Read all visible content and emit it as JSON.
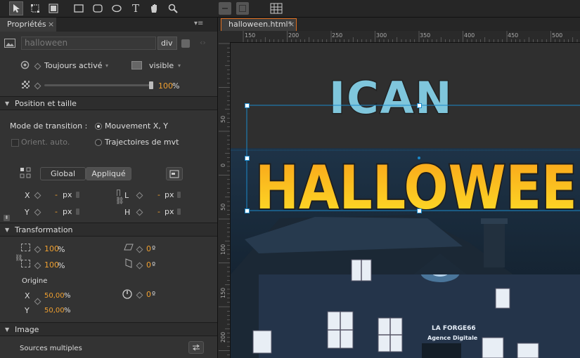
{
  "toolbar": {
    "tools": [
      {
        "name": "select-tool-icon",
        "selected": true
      },
      {
        "name": "transform-tool-icon"
      },
      {
        "name": "crop-tool-icon"
      },
      {
        "name": "rectangle-tool-icon"
      },
      {
        "name": "rounded-rectangle-tool-icon"
      },
      {
        "name": "ellipse-tool-icon"
      },
      {
        "name": "text-tool-icon",
        "glyph": "T"
      },
      {
        "name": "hand-tool-icon"
      },
      {
        "name": "zoom-tool-icon"
      }
    ]
  },
  "properties": {
    "tab_label": "Propriétés",
    "element_name": "halloween",
    "element_tag": "div",
    "display_label": "Toujours activé",
    "visibility_label": "visible",
    "opacity_value": "100",
    "opacity_unit": "%",
    "opacity_fraction": 1.0,
    "sections": {
      "position": "Position et taille",
      "transformation": "Transformation",
      "image": "Image"
    },
    "transition_mode_label": "Mode de transition :",
    "radio_xy": "Mouvement X, Y",
    "radio_path": "Trajectoires de mvt",
    "orient_auto": "Orient. auto.",
    "toggle_global": "Global",
    "toggle_applied": "Appliqué",
    "x_label": "X",
    "y_label": "Y",
    "l_label": "L",
    "h_label": "H",
    "dash": "-",
    "px": "px",
    "scale_x": "100",
    "scale_y": "100",
    "percent": "%",
    "skew_value": "0",
    "skew_unit": "º",
    "rotate_value": "0",
    "origin_label": "Origine",
    "origin_x": "50,00",
    "origin_y": "50,00",
    "origin_x_label": "X",
    "origin_y_label": "Y",
    "rotation_value": "0",
    "sources_label": "Sources multiples"
  },
  "document": {
    "tab_label": "halloween.html*",
    "ruler_h": [
      "150",
      "200",
      "250",
      "300",
      "350",
      "400",
      "450",
      "500"
    ],
    "ruler_v": [
      "50",
      "0",
      "50",
      "100",
      "150",
      "200"
    ],
    "artwork": {
      "title_line1": "ICAN",
      "title_line2": "HALLOWEEN",
      "sign_line1": "LA FORGE66",
      "sign_line2": "Agence Digitale"
    },
    "colors": {
      "selection": "#1b88c9",
      "ican_fill": "#7fc6dc",
      "halloween_top": "#f9a219",
      "halloween_bottom": "#fde028",
      "accent": "#f0a030"
    }
  }
}
